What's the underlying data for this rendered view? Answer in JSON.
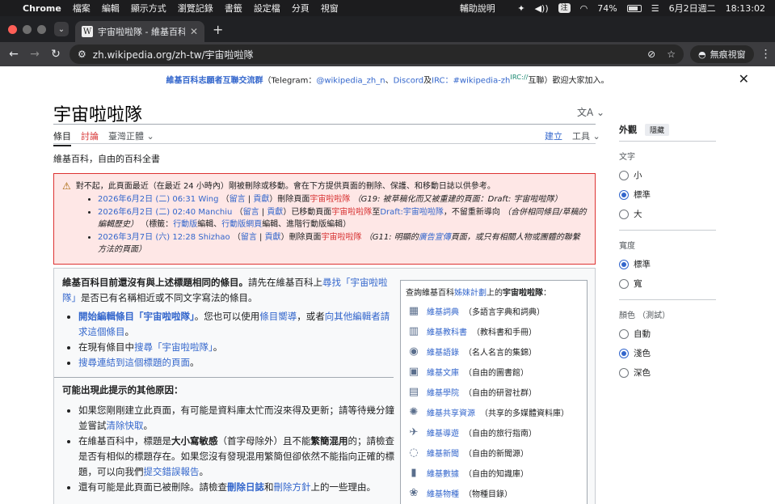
{
  "menubar": {
    "apple": "",
    "app": "Chrome",
    "items": [
      "檔案",
      "編輯",
      "顯示方式",
      "瀏覽記錄",
      "書籤",
      "設定檔",
      "分頁",
      "視窗"
    ],
    "help": "輔助說明",
    "input_badge": "注",
    "battery": "74%",
    "date": "6月2日週二",
    "time": "18:13:02"
  },
  "tab": {
    "favicon": "W",
    "title": "宇宙啦啦隊 - 維基百科，自由的百科全書"
  },
  "address": {
    "url": "zh.wikipedia.org/zh-tw/宇宙啦啦隊",
    "incognito": "無痕視窗"
  },
  "sitenotice": {
    "lead_link": "維基百科志願者互聯交流群",
    "text1": "（Telegram：",
    "tg": "@wikipedia_zh_n",
    "sep1": "、",
    "discord": "Discord",
    "and": "及",
    "irc": "IRC：#wikipedia-zh",
    "irc_sup": "IRC://",
    "tail": "互聯）歡迎大家加入。"
  },
  "article": {
    "title": "宇宙啦啦隊",
    "tab_article": "條目",
    "tab_talk": "討論",
    "variant": "臺灣正體",
    "create": "建立",
    "tools": "工具",
    "tagline": "維基百科，自由的百科全書"
  },
  "warning": {
    "head": "對不起，此頁面最近（在最近 24 小時內）剛被刪除或移動。會在下方提供頁面的刪除、保護、和移動日誌以供參考。",
    "entries": [
      {
        "date": "2026年6月2日 (二) 06:31",
        "user": "Wing",
        "talk": "留言",
        "contrib": "貢獻",
        "action": "刪除頁面",
        "page": "宇宙啦啦隊",
        "reason": "（G19: 被草稿化而又被重建的頁面：Draft: 宇宙啦啦隊）"
      },
      {
        "date": "2026年6月2日 (二) 02:40",
        "user": "Manchiu",
        "talk": "留言",
        "contrib": "貢獻",
        "action": "已移動頁面",
        "page": "宇宙啦啦隊",
        "to": "至",
        "target": "Draft:宇宙啦啦隊",
        "note": "，不留重新導向",
        "reason": "（合併相同條目/草稿的編輯歷史）",
        "tags_label": "標籤：",
        "tag1": "行動版",
        "tag1b": "編輯、",
        "tag2": "行動版網頁",
        "tag2b": "編輯、進階行動版編輯"
      },
      {
        "date": "2026年3月7日 (六) 12:28",
        "user": "Shizhao",
        "talk": "留言",
        "contrib": "貢獻",
        "action": "刪除頁面",
        "page": "宇宙啦啦隊",
        "reason_a": "（G11: 明顯的",
        "reason_link": "廣告宣傳",
        "reason_b": "頁面，或只有相關人物或團體的聯繫方法的頁面）"
      }
    ]
  },
  "main": {
    "intro_bold": "維基百科目前還沒有與上述標題相同的條目。",
    "intro_a": "請先在維基百科上",
    "intro_link": "尋找「宇宙啦啦隊」",
    "intro_b": "是否已有名稱相近或不同文字寫法的條目。",
    "bullets1": [
      {
        "link": "開始編輯條目「宇宙啦啦隊」",
        "a": "。您也可以使用",
        "link2": "條目嚮導",
        "b": "，或者",
        "link3": "向其他編輯者請求這個條目",
        "c": "。"
      },
      {
        "a": "在現有條目中",
        "link": "搜尋「宇宙啦啦隊」",
        "b": "。"
      },
      {
        "link": "搜尋連結到這個標題的頁面",
        "b": "。"
      }
    ],
    "reasons_head": "可能出現此提示的其他原因：",
    "bullets2": [
      {
        "a": "如果您剛剛建立此頁面，有可能是資料庫太忙而沒來得及更新；請等待幾分鐘並嘗試",
        "link": "清除快取",
        "b": "。"
      },
      {
        "a": "在維基百科中，標題是",
        "bold1": "大小寫敏感",
        "b": "（首字母除外）且不能",
        "bold2": "繁簡混用",
        "c": "的；請檢查是否有相似的標題存在。如果您沒有發現混用繁簡但卻依然不能指向正確的標題，可以向我們",
        "link": "提交錯誤報告",
        "d": "。"
      },
      {
        "a": "還有可能是此頁面已被刪除。請檢查",
        "link1": "刪除日誌",
        "b": "和",
        "link2": "刪除方針",
        "c": "上的一些理由。"
      }
    ]
  },
  "sister": {
    "head_a": "查詢維基百科",
    "head_link": "姊妹計劃",
    "head_b": "上的",
    "head_bold": "宇宙啦啦隊",
    "head_c": "：",
    "items": [
      {
        "icon": "wiktionary-icon",
        "glyph": "▦",
        "link": "維基詞典",
        "desc": "（多語言字典和詞典）"
      },
      {
        "icon": "wikibooks-icon",
        "glyph": "▥",
        "link": "維基教科書",
        "desc": "（教科書和手冊）"
      },
      {
        "icon": "wikiquote-icon",
        "glyph": "◉",
        "link": "維基語錄",
        "desc": "（名人名言的集錦）"
      },
      {
        "icon": "wikisource-icon",
        "glyph": "▣",
        "link": "維基文庫",
        "desc": "（自由的圖書館）"
      },
      {
        "icon": "wikiversity-icon",
        "glyph": "▤",
        "link": "維基學院",
        "desc": "（自由的研習社群）"
      },
      {
        "icon": "commons-icon",
        "glyph": "✺",
        "link": "維基共享資源",
        "desc": "（共享的多媒體資料庫）"
      },
      {
        "icon": "wikivoyage-icon",
        "glyph": "✈",
        "link": "維基導遊",
        "desc": "（自由的旅行指南）"
      },
      {
        "icon": "wikinews-icon",
        "glyph": "◌",
        "link": "維基新聞",
        "desc": "（自由的新聞源）"
      },
      {
        "icon": "wikidata-icon",
        "glyph": "▮",
        "link": "維基數據",
        "desc": "（自由的知識庫）"
      },
      {
        "icon": "wikispecies-icon",
        "glyph": "❀",
        "link": "維基物種",
        "desc": "（物種目錄）"
      }
    ]
  },
  "appearance": {
    "title": "外觀",
    "hide": "隱藏",
    "text_label": "文字",
    "text_opts": [
      {
        "label": "小",
        "on": false
      },
      {
        "label": "標準",
        "on": true
      },
      {
        "label": "大",
        "on": false
      }
    ],
    "width_label": "寬度",
    "width_opts": [
      {
        "label": "標準",
        "on": true
      },
      {
        "label": "寬",
        "on": false
      }
    ],
    "color_label": "顏色 （測試）",
    "color_opts": [
      {
        "label": "自動",
        "on": false
      },
      {
        "label": "淺色",
        "on": true
      },
      {
        "label": "深色",
        "on": false
      }
    ]
  }
}
